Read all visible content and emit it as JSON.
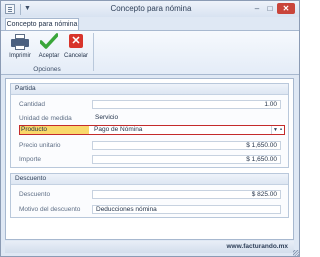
{
  "window": {
    "title": "Concepto para nómina"
  },
  "ribbon": {
    "tab_label": "Concepto para nómina",
    "group_label": "Opciones",
    "buttons": {
      "print": "Imprimir",
      "accept": "Aceptar",
      "cancel": "Cancelar"
    }
  },
  "partida": {
    "header": "Partida",
    "cantidad": {
      "label": "Cantidad",
      "value": "1.00"
    },
    "unidad": {
      "label": "Unidad de medida",
      "value": "Servicio"
    },
    "producto": {
      "label": "Producto",
      "value": "Pago de Nómina"
    },
    "precio": {
      "label": "Precio unitario",
      "value": "$ 1,650.00"
    },
    "importe": {
      "label": "Importe",
      "value": "$ 1,650.00"
    }
  },
  "descuento": {
    "header": "Descuento",
    "descuento": {
      "label": "Descuento",
      "value": "$ 825.00"
    },
    "motivo": {
      "label": "Motivo del descuento",
      "value": "Deducciones nómina"
    }
  },
  "footer": {
    "brand": "www.facturando.mx"
  },
  "colors": {
    "highlight_fill": "#f9d86a",
    "highlight_border": "#c42b2b",
    "close_button": "#c9453b",
    "accept_check": "#3aa63a",
    "cancel_red": "#d8342b"
  }
}
